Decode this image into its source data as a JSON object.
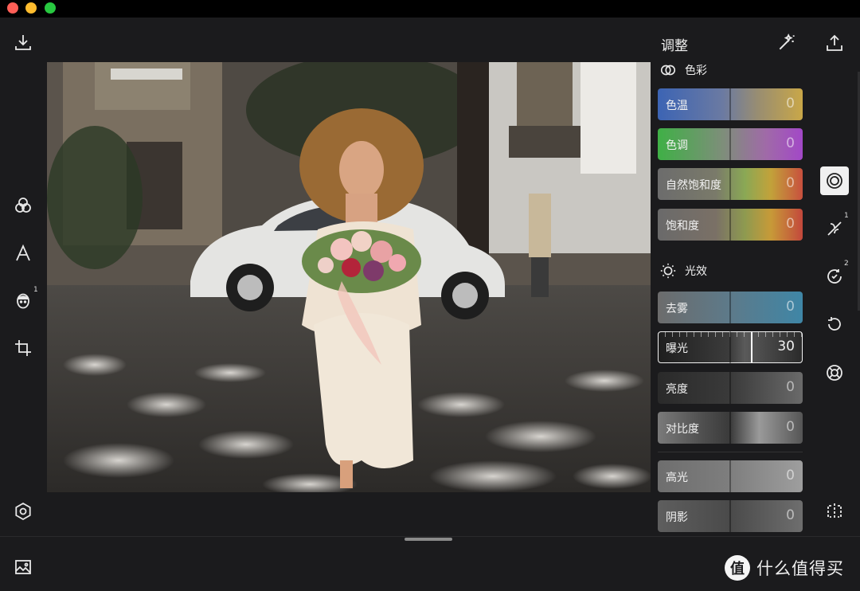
{
  "panel": {
    "title": "调整",
    "color_section": "色彩",
    "light_section": "光效",
    "sliders": {
      "temperature": {
        "label": "色温",
        "value": "0"
      },
      "tint": {
        "label": "色调",
        "value": "0"
      },
      "vibrance": {
        "label": "自然饱和度",
        "value": "0"
      },
      "saturation": {
        "label": "饱和度",
        "value": "0"
      },
      "dehaze": {
        "label": "去雾",
        "value": "0"
      },
      "exposure": {
        "label": "曝光",
        "value": "30"
      },
      "brightness": {
        "label": "亮度",
        "value": "0"
      },
      "contrast": {
        "label": "对比度",
        "value": "0"
      },
      "highlights": {
        "label": "高光",
        "value": "0"
      },
      "shadows": {
        "label": "阴影",
        "value": "0"
      }
    }
  },
  "badges": {
    "face": "1",
    "heal": "1",
    "history": "2"
  },
  "watermark": {
    "logo": "值",
    "text": "什么值得买"
  },
  "icons": [
    "download-icon",
    "filters-icon",
    "text-icon",
    "face-icon",
    "crop-icon",
    "settings-icon",
    "image-icon",
    "wand-icon",
    "share-icon",
    "adjust-icon",
    "heal-icon",
    "history-icon",
    "undo-icon",
    "lens-icon",
    "compare-icon"
  ],
  "colors": {
    "background": "#1b1b1d",
    "accent_active": "#f0f0f0"
  }
}
